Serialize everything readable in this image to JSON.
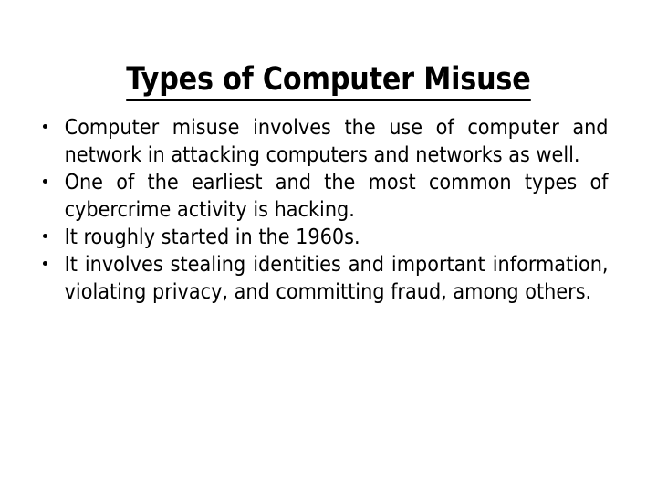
{
  "slide": {
    "title": "Types of Computer Misuse",
    "title_underlined": true,
    "background_color": "#ffffff",
    "text_color": "#000000",
    "bullets": [
      {
        "text": "Computer misuse involves the use of computer and network in attacking computers and networks as well."
      },
      {
        "text": "One of the earliest and the most common types of cybercrime activity is hacking."
      },
      {
        "text": "It roughly started in the 1960s."
      },
      {
        "text": "It involves stealing identities and important information, violating privacy, and committing fraud, among others."
      }
    ]
  }
}
